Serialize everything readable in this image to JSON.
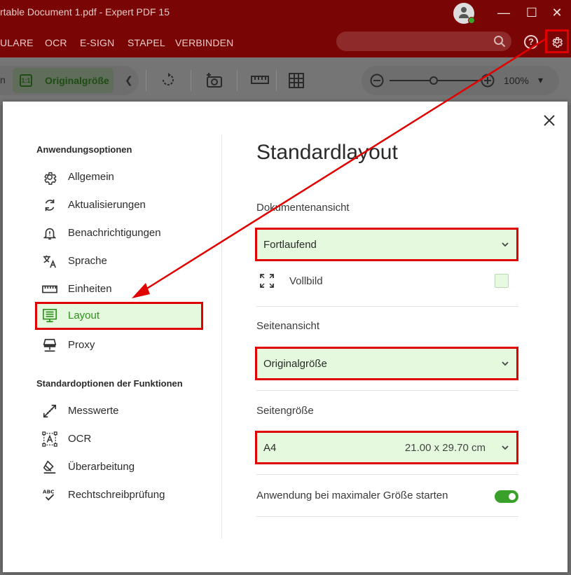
{
  "window": {
    "title": "rtable Document 1.pdf  -  Expert PDF 15",
    "minimize_glyph": "—",
    "maximize_glyph": "☐",
    "close_glyph": "✕"
  },
  "menu": {
    "items": [
      "ULARE",
      "OCR",
      "E-SIGN",
      "STAPEL",
      "VERBINDEN"
    ],
    "help_glyph": "?"
  },
  "toolbar": {
    "partial_label": "n",
    "active_view": "Originalgröße",
    "active_icon_text": "1:1",
    "zoom_value": "100%"
  },
  "dialog": {
    "sections": [
      {
        "heading": "Anwendungsoptionen",
        "items": [
          {
            "label": "Allgemein",
            "icon": "gear-icon"
          },
          {
            "label": "Aktualisierungen",
            "icon": "refresh-icon"
          },
          {
            "label": "Benachrichtigungen",
            "icon": "bell-icon"
          },
          {
            "label": "Sprache",
            "icon": "translate-icon"
          },
          {
            "label": "Einheiten",
            "icon": "ruler-icon"
          },
          {
            "label": "Layout",
            "icon": "layout-icon",
            "active": true
          },
          {
            "label": "Proxy",
            "icon": "proxy-icon"
          }
        ]
      },
      {
        "heading": "Standardoptionen der Funktionen",
        "items": [
          {
            "label": "Messwerte",
            "icon": "measure-icon"
          },
          {
            "label": "OCR",
            "icon": "ocr-icon"
          },
          {
            "label": "Überarbeitung",
            "icon": "eraser-icon"
          },
          {
            "label": "Rechtschreibprüfung",
            "icon": "spellcheck-icon"
          }
        ]
      }
    ],
    "content": {
      "title": "Standardlayout",
      "document_view": {
        "label": "Dokumentenansicht",
        "value": "Fortlaufend"
      },
      "fullscreen": {
        "label": "Vollbild",
        "checked": false
      },
      "page_view": {
        "label": "Seitenansicht",
        "value": "Originalgröße"
      },
      "page_size": {
        "label": "Seitengröße",
        "value": "A4",
        "dimensions": "21.00 x 29.70 cm"
      },
      "start_maximized": {
        "label": "Anwendung bei maximaler Größe starten",
        "on": true
      }
    }
  },
  "colors": {
    "brand_red": "#7a0505",
    "highlight_red": "#e00000",
    "accent_green": "#2e8f1c",
    "selection_bg": "#e4f9dd"
  }
}
